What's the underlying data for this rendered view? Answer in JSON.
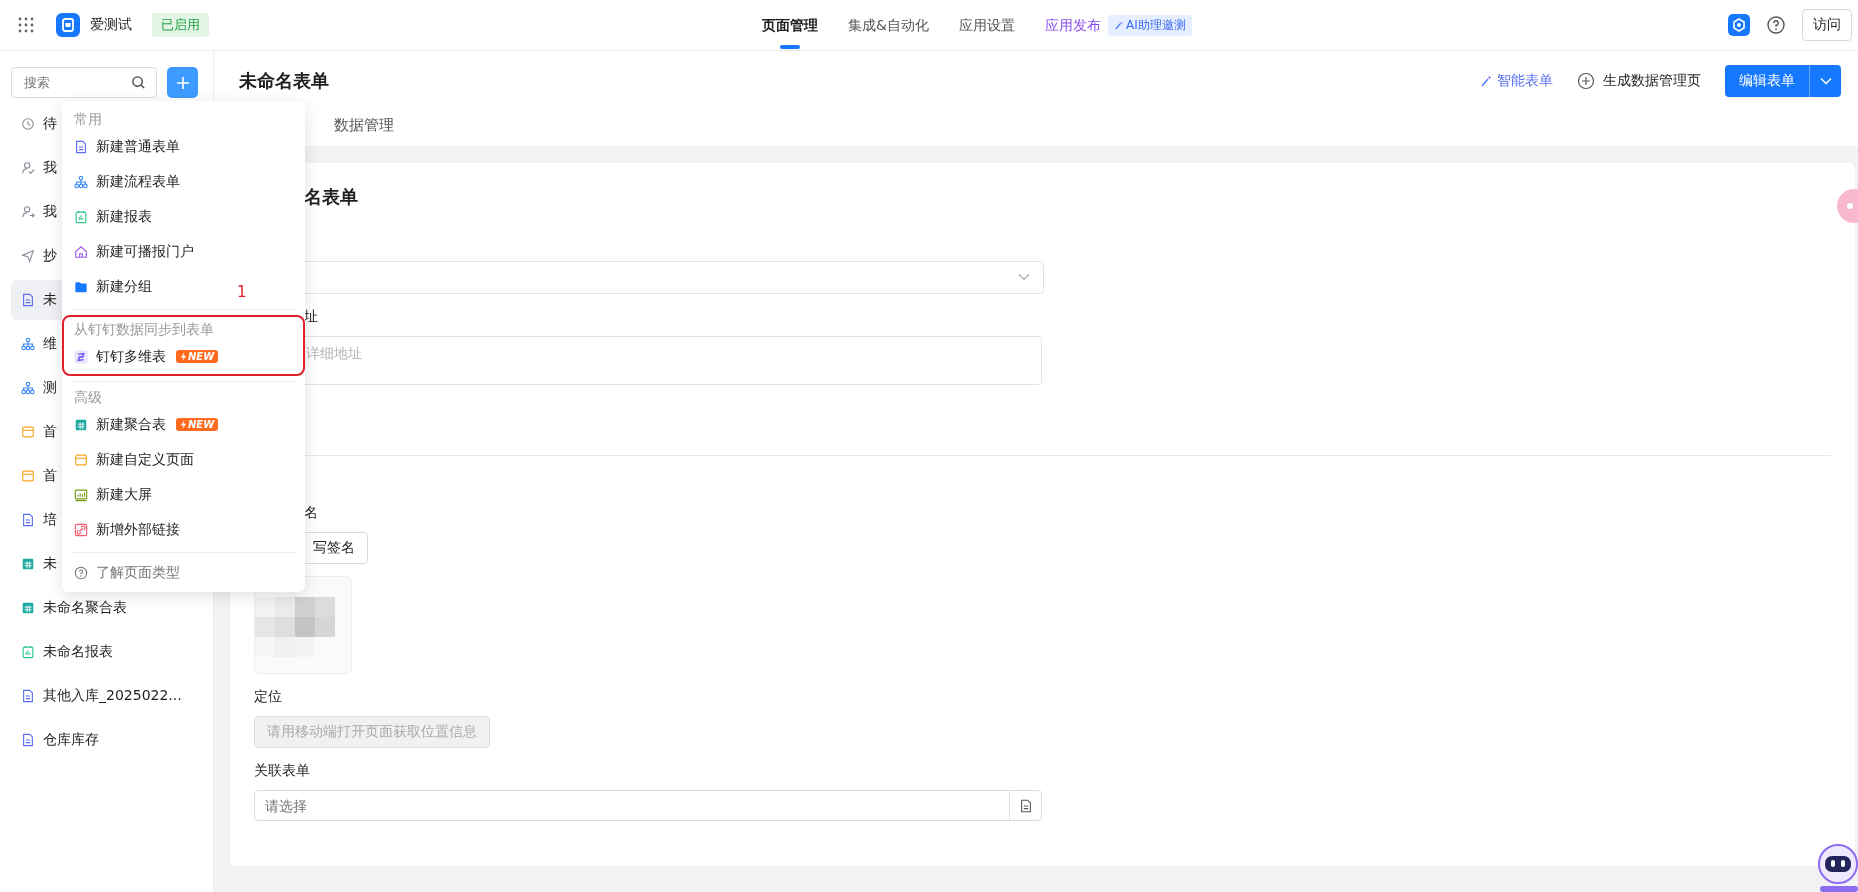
{
  "topbar": {
    "app_name": "爱测试",
    "status_badge": "已启用",
    "nav": [
      {
        "label": "页面管理",
        "selected": true,
        "kind": "plain"
      },
      {
        "label": "集成&自动化",
        "selected": false,
        "kind": "plain"
      },
      {
        "label": "应用设置",
        "selected": false,
        "kind": "plain"
      },
      {
        "label": "应用发布",
        "selected": false,
        "kind": "promo"
      }
    ],
    "ai_tag": "AI助理邀测",
    "visit_button": "访问"
  },
  "sidebar": {
    "search": {
      "placeholder": "搜索"
    },
    "items": [
      {
        "label": "待",
        "kind": "clock",
        "selected": false
      },
      {
        "label": "我",
        "kind": "person-check",
        "selected": false
      },
      {
        "label": "我",
        "kind": "person-arrow",
        "selected": false
      },
      {
        "label": "抄",
        "kind": "send",
        "selected": false
      },
      {
        "label": "未",
        "kind": "form",
        "selected": true
      },
      {
        "label": "维",
        "kind": "flow",
        "selected": false
      },
      {
        "label": "测",
        "kind": "flow",
        "selected": false
      },
      {
        "label": "首",
        "kind": "page",
        "selected": false
      },
      {
        "label": "首",
        "kind": "page",
        "selected": false
      },
      {
        "label": "培",
        "kind": "form",
        "selected": false
      },
      {
        "label": "未",
        "kind": "aggregate",
        "selected": false
      },
      {
        "label": "未命名聚合表",
        "kind": "aggregate",
        "selected": false
      },
      {
        "label": "未命名报表",
        "kind": "report",
        "selected": false
      },
      {
        "label": "其他入库_2025022...",
        "kind": "form",
        "selected": false
      },
      {
        "label": "仓库库存",
        "kind": "form",
        "selected": false
      }
    ]
  },
  "create_menu": {
    "sections": [
      {
        "heading": "常用",
        "annotated": false,
        "items": [
          {
            "label": "新建普通表单",
            "kind": "form"
          },
          {
            "label": "新建流程表单",
            "kind": "flow"
          },
          {
            "label": "新建报表",
            "kind": "report"
          },
          {
            "label": "新建可播报门户",
            "kind": "home"
          },
          {
            "label": "新建分组",
            "kind": "folder"
          }
        ]
      },
      {
        "heading": "从钉钉数据同步到表单",
        "annotated": true,
        "items": [
          {
            "label": "钉钉多维表",
            "kind": "multitable",
            "new": "NEW"
          }
        ]
      },
      {
        "heading": "高级",
        "annotated": false,
        "items": [
          {
            "label": "新建聚合表",
            "kind": "aggregate",
            "new": "NEW"
          },
          {
            "label": "新建自定义页面",
            "kind": "page"
          },
          {
            "label": "新建大屏",
            "kind": "screen"
          },
          {
            "label": "新增外部链接",
            "kind": "link"
          }
        ]
      }
    ],
    "annotation_number": "1",
    "footer": "了解页面类型"
  },
  "page": {
    "title": "未命名表单",
    "tabs": [
      {
        "label": "数据管理",
        "selected": false
      }
    ],
    "smart_form": "智能表单",
    "generate": "生成数据管理页",
    "edit_button": "编辑表单"
  },
  "form": {
    "heading": "名表单",
    "fields": [
      {
        "kind": "select"
      },
      {
        "kind": "textarea",
        "label": "址",
        "placeholder": "详细地址"
      },
      {
        "kind": "divider"
      },
      {
        "kind": "signature",
        "label": "名",
        "button": "写签名"
      },
      {
        "kind": "location",
        "label": "定位",
        "button": "请用移动端打开页面获取位置信息"
      },
      {
        "kind": "lookup",
        "label": "关联表单",
        "placeholder": "请选择"
      }
    ]
  }
}
